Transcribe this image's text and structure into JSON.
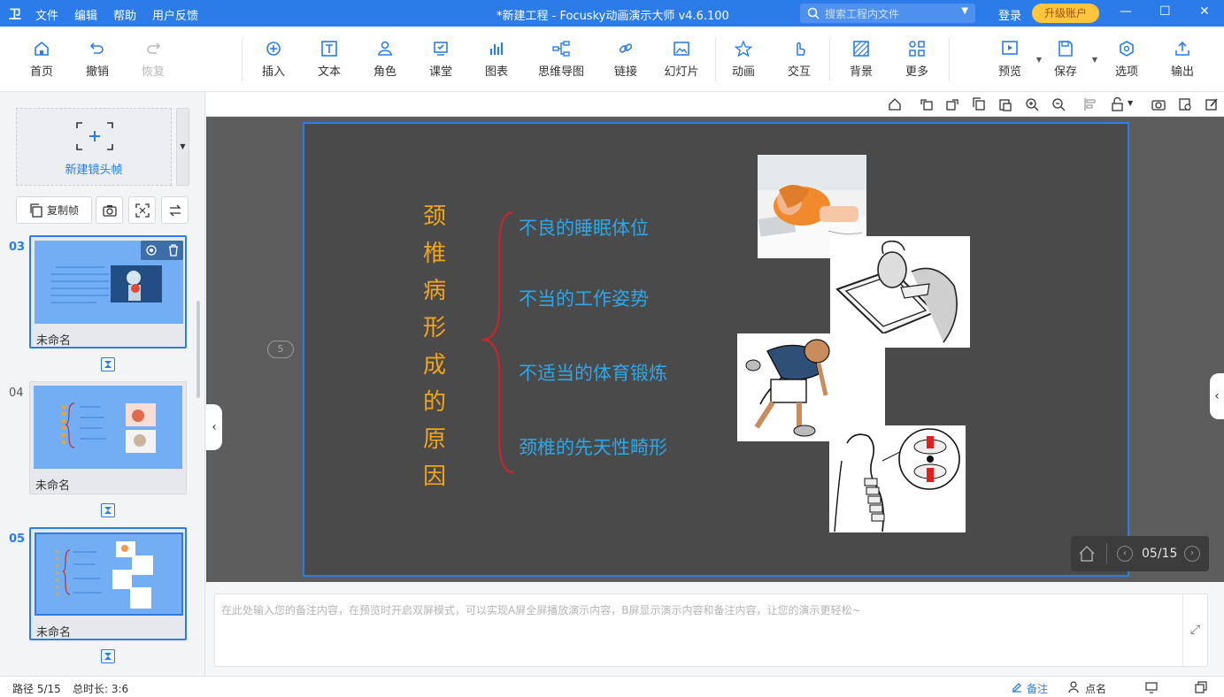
{
  "window": {
    "logo": "卫",
    "menu": [
      "文件",
      "编辑",
      "帮助",
      "用户反馈"
    ],
    "title": "*新建工程 - Focusky动画演示大师  v4.6.100",
    "search_placeholder": "搜索工程内文件",
    "login": "登录",
    "upgrade": "升级账户"
  },
  "toolbar": {
    "home": "首页",
    "undo": "撤销",
    "redo": "恢复",
    "insert": "插入",
    "text": "文本",
    "role": "角色",
    "class": "课堂",
    "chart": "图表",
    "mindmap": "思维导图",
    "link": "链接",
    "slides": "幻灯片",
    "animation": "动画",
    "interaction": "交互",
    "background": "背景",
    "more": "更多",
    "preview": "预览",
    "save": "保存",
    "options": "选项",
    "export": "输出"
  },
  "sidebar": {
    "new_frame": "新建镜头帧",
    "copy_frame": "复制帧",
    "frames": [
      {
        "num": "03",
        "name": "未命名",
        "active": false,
        "selected": true
      },
      {
        "num": "04",
        "name": "未命名",
        "active": false,
        "selected": false
      },
      {
        "num": "05",
        "name": "未命名",
        "active": true,
        "selected": false
      }
    ]
  },
  "slide": {
    "frame_badge": "5",
    "vertical_title": [
      "颈",
      "椎",
      "病",
      "形",
      "成",
      "的",
      "原",
      "因"
    ],
    "items": [
      "不良的睡眠体位",
      "不当的工作姿势",
      "不适当的体育锻炼",
      "颈椎的先天性畸形"
    ],
    "page_indicator": "05/15"
  },
  "notes": {
    "placeholder": "在此处输入您的备注内容，在预览时开启双屏模式，可以实现A屏全屏播放演示内容，B屏显示演示内容和备注内容，让您的演示更轻松~"
  },
  "status": {
    "path": "路径 5/15",
    "duration": "总时长: 3:6",
    "notes": "备注",
    "roll_call": "点名"
  },
  "colors": {
    "accent": "#2b7ce9",
    "title_orange": "#f2a41d",
    "item_blue": "#2ea7e8",
    "brace_red": "#d0232a",
    "upgrade_gold": "#ffc53d"
  }
}
